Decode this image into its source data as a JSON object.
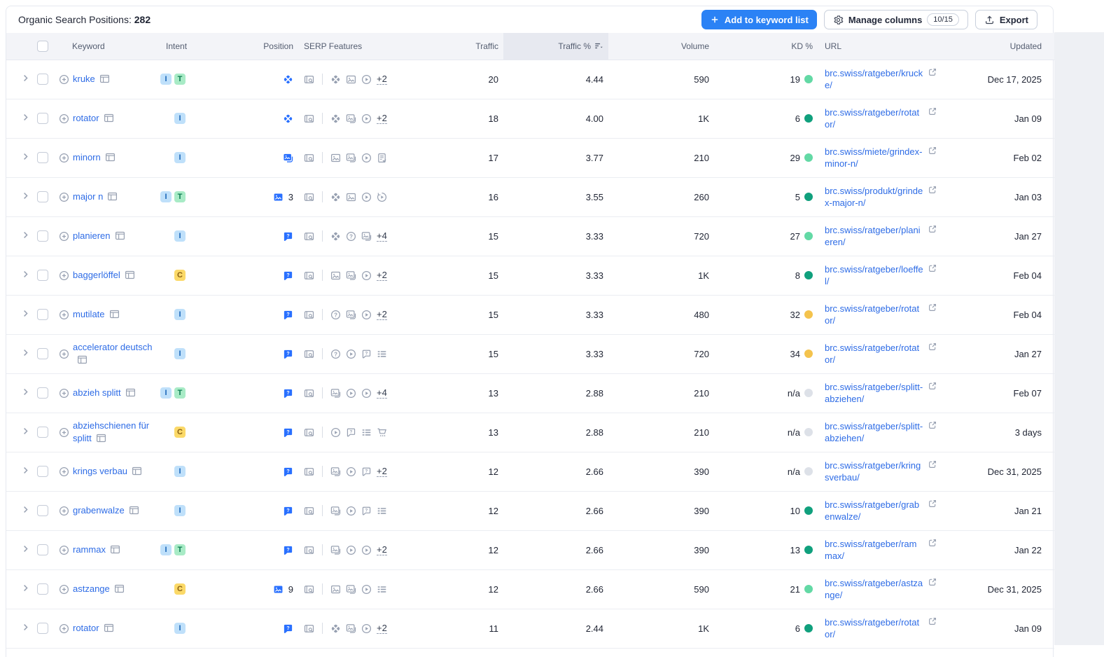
{
  "header": {
    "title": "Organic Search Positions:",
    "count": "282",
    "add_button_label": "Add to keyword list",
    "manage_columns_label": "Manage columns",
    "manage_columns_badge": "10/15",
    "export_label": "Export"
  },
  "table": {
    "columns": {
      "keyword": "Keyword",
      "intent": "Intent",
      "position": "Position",
      "serp_features": "SERP Features",
      "traffic": "Traffic",
      "traffic_pct": "Traffic %",
      "volume": "Volume",
      "kd": "KD %",
      "url": "URL",
      "updated": "Updated"
    },
    "sorted_column": "traffic_pct",
    "rows": [
      {
        "keyword": "kruke",
        "intents": [
          "I",
          "T"
        ],
        "pos_icon": "featured-snippet",
        "pos_num": "",
        "features": [
          "featured-snippet",
          "images",
          "video"
        ],
        "more": "+2",
        "traffic": "20",
        "traffic_pct": "4.44",
        "volume": "590",
        "kd": "19",
        "kd_level": "easy",
        "url": "brc.swiss/ratgeber/krucke/",
        "updated": "Dec 17, 2025"
      },
      {
        "keyword": "rotator",
        "intents": [
          "I"
        ],
        "pos_icon": "featured-snippet",
        "pos_num": "",
        "features": [
          "featured-snippet",
          "image-pack",
          "video"
        ],
        "more": "+2",
        "traffic": "18",
        "traffic_pct": "4.00",
        "volume": "1K",
        "kd": "6",
        "kd_level": "very_easy",
        "url": "brc.swiss/ratgeber/rotator/",
        "updated": "Jan 09"
      },
      {
        "keyword": "minorn",
        "intents": [
          "I"
        ],
        "pos_icon": "image-pack",
        "pos_num": "",
        "features": [
          "images",
          "image-pack",
          "video",
          "doc-check"
        ],
        "more": "",
        "traffic": "17",
        "traffic_pct": "3.77",
        "volume": "210",
        "kd": "29",
        "kd_level": "easy",
        "url": "brc.swiss/miete/grindex-minor-n/",
        "updated": "Feb 02"
      },
      {
        "keyword": "major n",
        "intents": [
          "I",
          "T"
        ],
        "pos_icon": "images",
        "pos_num": "3",
        "features": [
          "featured-snippet",
          "images",
          "video",
          "video-carousel"
        ],
        "more": "",
        "traffic": "16",
        "traffic_pct": "3.55",
        "volume": "260",
        "kd": "5",
        "kd_level": "very_easy",
        "url": "brc.swiss/produkt/grindex-major-n/",
        "updated": "Jan 03"
      },
      {
        "keyword": "planieren",
        "intents": [
          "I"
        ],
        "pos_icon": "people-also-ask",
        "pos_num": "",
        "features": [
          "featured-snippet",
          "question",
          "image-pack"
        ],
        "more": "+4",
        "traffic": "15",
        "traffic_pct": "3.33",
        "volume": "720",
        "kd": "27",
        "kd_level": "easy",
        "url": "brc.swiss/ratgeber/planieren/",
        "updated": "Jan 27"
      },
      {
        "keyword": "baggerlöffel",
        "intents": [
          "C"
        ],
        "pos_icon": "people-also-ask",
        "pos_num": "",
        "features": [
          "images",
          "image-pack",
          "video"
        ],
        "more": "+2",
        "traffic": "15",
        "traffic_pct": "3.33",
        "volume": "1K",
        "kd": "8",
        "kd_level": "very_easy",
        "url": "brc.swiss/ratgeber/loeffel/",
        "updated": "Feb 04"
      },
      {
        "keyword": "mutilate",
        "intents": [
          "I"
        ],
        "pos_icon": "people-also-ask",
        "pos_num": "",
        "features": [
          "question",
          "image-pack",
          "video"
        ],
        "more": "+2",
        "traffic": "15",
        "traffic_pct": "3.33",
        "volume": "480",
        "kd": "32",
        "kd_level": "possible",
        "url": "brc.swiss/ratgeber/rotator/",
        "updated": "Feb 04"
      },
      {
        "keyword": "accelerator deutsch",
        "intents": [
          "I"
        ],
        "pos_icon": "people-also-ask",
        "pos_num": "",
        "features": [
          "question",
          "video",
          "people-also-ask",
          "list"
        ],
        "more": "",
        "traffic": "15",
        "traffic_pct": "3.33",
        "volume": "720",
        "kd": "34",
        "kd_level": "possible",
        "url": "brc.swiss/ratgeber/rotator/",
        "updated": "Jan 27"
      },
      {
        "keyword": "abzieh splitt",
        "intents": [
          "I",
          "T"
        ],
        "pos_icon": "people-also-ask",
        "pos_num": "",
        "features": [
          "image-pack",
          "video",
          "video"
        ],
        "more": "+4",
        "traffic": "13",
        "traffic_pct": "2.88",
        "volume": "210",
        "kd": "n/a",
        "kd_level": "na",
        "url": "brc.swiss/ratgeber/splitt-abziehen/",
        "updated": "Feb 07"
      },
      {
        "keyword": "abziehschienen für splitt",
        "intents": [
          "C"
        ],
        "pos_icon": "people-also-ask",
        "pos_num": "",
        "features": [
          "video",
          "people-also-ask",
          "list",
          "cart"
        ],
        "more": "",
        "traffic": "13",
        "traffic_pct": "2.88",
        "volume": "210",
        "kd": "n/a",
        "kd_level": "na",
        "url": "brc.swiss/ratgeber/splitt-abziehen/",
        "updated": "3 days"
      },
      {
        "keyword": "krings verbau",
        "intents": [
          "I"
        ],
        "pos_icon": "people-also-ask",
        "pos_num": "",
        "features": [
          "image-pack",
          "video",
          "people-also-ask"
        ],
        "more": "+2",
        "traffic": "12",
        "traffic_pct": "2.66",
        "volume": "390",
        "kd": "n/a",
        "kd_level": "na",
        "url": "brc.swiss/ratgeber/kringsverbau/",
        "updated": "Dec 31, 2025"
      },
      {
        "keyword": "grabenwalze",
        "intents": [
          "I"
        ],
        "pos_icon": "people-also-ask",
        "pos_num": "",
        "features": [
          "image-pack",
          "video",
          "people-also-ask",
          "list"
        ],
        "more": "",
        "traffic": "12",
        "traffic_pct": "2.66",
        "volume": "390",
        "kd": "10",
        "kd_level": "very_easy",
        "url": "brc.swiss/ratgeber/grabenwalze/",
        "updated": "Jan 21"
      },
      {
        "keyword": "rammax",
        "intents": [
          "I",
          "T"
        ],
        "pos_icon": "people-also-ask",
        "pos_num": "",
        "features": [
          "image-pack",
          "video",
          "video"
        ],
        "more": "+2",
        "traffic": "12",
        "traffic_pct": "2.66",
        "volume": "390",
        "kd": "13",
        "kd_level": "very_easy",
        "url": "brc.swiss/ratgeber/rammax/",
        "updated": "Jan 22"
      },
      {
        "keyword": "astzange",
        "intents": [
          "C"
        ],
        "pos_icon": "images",
        "pos_num": "9",
        "features": [
          "images",
          "image-pack",
          "video",
          "list"
        ],
        "more": "",
        "traffic": "12",
        "traffic_pct": "2.66",
        "volume": "590",
        "kd": "21",
        "kd_level": "easy",
        "url": "brc.swiss/ratgeber/astzange/",
        "updated": "Dec 31, 2025"
      },
      {
        "keyword": "rotator",
        "intents": [
          "I"
        ],
        "pos_icon": "people-also-ask",
        "pos_num": "",
        "features": [
          "featured-snippet",
          "image-pack",
          "video"
        ],
        "more": "+2",
        "traffic": "11",
        "traffic_pct": "2.44",
        "volume": "1K",
        "kd": "6",
        "kd_level": "very_easy",
        "url": "brc.swiss/ratgeber/rotator/",
        "updated": "Jan 09"
      }
    ]
  },
  "colors": {
    "accent_blue": "#2970ff",
    "link_blue": "#2e6ce6",
    "primary_button": "#2b82f5",
    "kd_very_easy": "#10a07d",
    "kd_easy": "#63d9a5",
    "kd_possible": "#f4c34d",
    "kd_na": "#dde1e8",
    "intent_informational_bg": "#bfe0fa",
    "intent_transactional_bg": "#a8ebc6",
    "intent_commercial_bg": "#fbd968"
  }
}
